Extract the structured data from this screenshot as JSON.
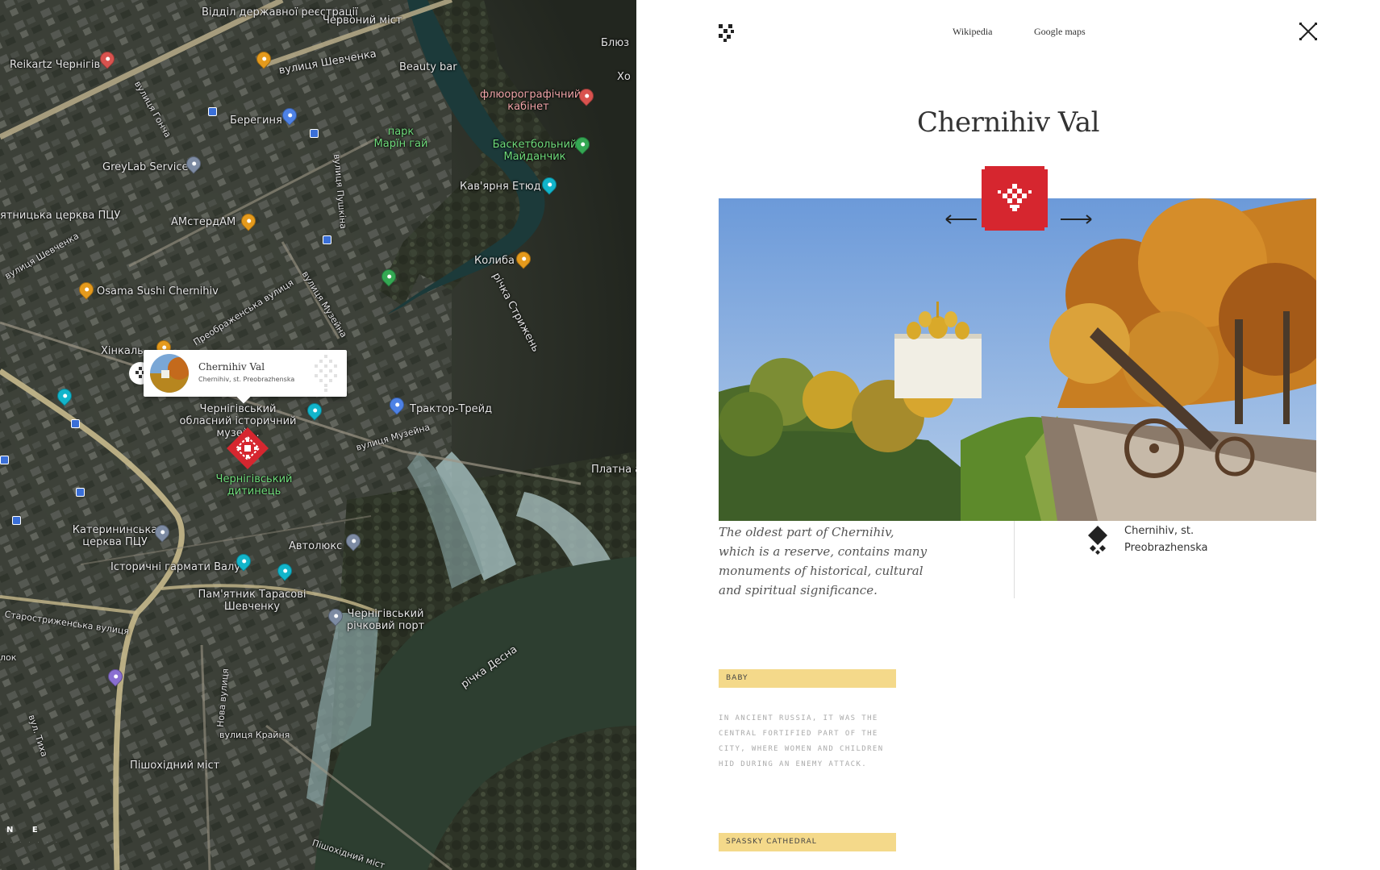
{
  "map": {
    "labels": [
      {
        "text": "Відділ державної реєстрації",
        "kind": "normal"
      },
      {
        "text": "Червоний міст",
        "kind": "normal"
      },
      {
        "text": "Reikartz Чернігів",
        "kind": "normal"
      },
      {
        "text": "вулиця Шевченка",
        "kind": "normal"
      },
      {
        "text": "Beauty bar",
        "kind": "normal"
      },
      {
        "text": "Блюз",
        "kind": "normal"
      },
      {
        "text": "Хо",
        "kind": "normal"
      },
      {
        "text": "вулиця Гонча",
        "kind": "normal"
      },
      {
        "text": "флюорографічний кабінет",
        "kind": "pink"
      },
      {
        "text": "Берегиня",
        "kind": "normal"
      },
      {
        "text": "парк Марїн гай",
        "kind": "green"
      },
      {
        "text": "Баскетбольний Майданчик",
        "kind": "green"
      },
      {
        "text": "GreyLab Service",
        "kind": "normal"
      },
      {
        "text": "вулиця Пушкіна",
        "kind": "normal"
      },
      {
        "text": "Кав'ярня Етюд",
        "kind": "normal"
      },
      {
        "text": "ятницька церква ПЦУ",
        "kind": "normal"
      },
      {
        "text": "АМстердАМ",
        "kind": "normal"
      },
      {
        "text": "вулиця Шевченка",
        "kind": "normal"
      },
      {
        "text": "Колиба",
        "kind": "normal"
      },
      {
        "text": "Osama Sushi Chernihiv",
        "kind": "normal"
      },
      {
        "text": "Преображенська вулиця",
        "kind": "normal"
      },
      {
        "text": "вулиця Музейна",
        "kind": "normal"
      },
      {
        "text": "річка Стрижень",
        "kind": "normal"
      },
      {
        "text": "Хінкаль",
        "kind": "normal"
      },
      {
        "text": "Чернігівський обласний історичний музей...",
        "kind": "normal"
      },
      {
        "text": "Трактор-Трейд",
        "kind": "normal"
      },
      {
        "text": "вулиця Музейна",
        "kind": "normal"
      },
      {
        "text": "Чернігівський дитинець",
        "kind": "green"
      },
      {
        "text": "Платна а",
        "kind": "normal"
      },
      {
        "text": "Катерининська церква ПЦУ",
        "kind": "normal"
      },
      {
        "text": "Автолюкс",
        "kind": "normal"
      },
      {
        "text": "Історичні гармати Валу",
        "kind": "normal"
      },
      {
        "text": "Пам'ятник Тарасові Шевченку",
        "kind": "normal"
      },
      {
        "text": "Старостриженська вулиця",
        "kind": "normal"
      },
      {
        "text": "Чернігівський річковий порт",
        "kind": "normal"
      },
      {
        "text": "річка Десна",
        "kind": "normal"
      },
      {
        "text": "лок",
        "kind": "normal"
      },
      {
        "text": "Нова вулиця",
        "kind": "normal"
      },
      {
        "text": "вулиця Крайня",
        "kind": "normal"
      },
      {
        "text": "вул. Тиха",
        "kind": "normal"
      },
      {
        "text": "Пішохідний міст",
        "kind": "normal"
      },
      {
        "text": "Пішохідний міст",
        "kind": "normal"
      }
    ],
    "popup": {
      "title": "Chernihiv Val",
      "address": "Chernihiv, st. Preobrazhenska"
    },
    "bottom_logo": "N E",
    "bottom_logo_sub": "· · · · · · ·"
  },
  "panel": {
    "nav": {
      "wikipedia": "Wikipedia",
      "google_maps": "Google maps"
    },
    "title": "Chernihiv Val",
    "description": "The oldest part of Chernihiv, which is a reserve, contains many monuments of historical, cultural and spiritual significance.",
    "address": "Chernihiv, st. Preobrazhenska",
    "sections": [
      {
        "tag": "Baby",
        "text": "In ancient Russia, it was the central fortified part of the city, where women and children hid during an enemy attack."
      },
      {
        "tag": "Spassky Cathedral",
        "text": ""
      }
    ],
    "colors": {
      "accent": "#d6262f",
      "tag_bg": "#f4d98a"
    }
  }
}
